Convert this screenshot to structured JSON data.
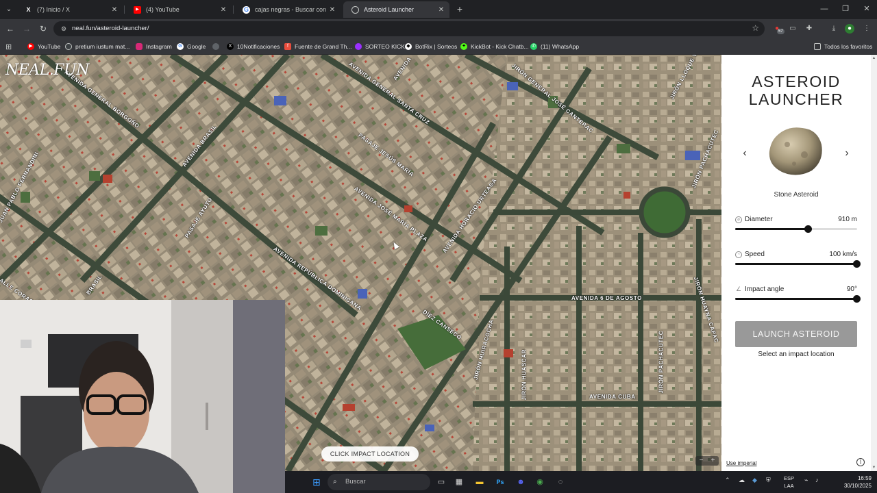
{
  "browser": {
    "tabs": [
      {
        "title": "(7) Inicio / X",
        "icon": "x-logo-icon",
        "active": false
      },
      {
        "title": "(4) YouTube",
        "icon": "youtube-icon",
        "active": false
      },
      {
        "title": "cajas negras - Buscar con Google",
        "icon": "google-icon",
        "active": false
      },
      {
        "title": "Asteroid Launcher",
        "icon": "neal-fun-icon",
        "active": true
      }
    ],
    "new_tab": "+",
    "url": "neal.fun/asteroid-launcher/",
    "extension_badge": "57",
    "bookmarks": [
      {
        "label": "YouTube",
        "color": "#ff0000"
      },
      {
        "label": "pretium iustum mat...",
        "color": "#4285f4"
      },
      {
        "label": "Instagram",
        "color": "#d62976"
      },
      {
        "label": "Google",
        "color": "#4285f4"
      },
      {
        "label": "",
        "color": "#9aa0a6"
      },
      {
        "label": "10Notificaciones",
        "color": "#000000"
      },
      {
        "label": "Fuente de Grand Th...",
        "color": "#e84d3d"
      },
      {
        "label": "SORTEO KICK",
        "color": "#9b30ff"
      },
      {
        "label": "BotRix | Sorteos",
        "color": "#ffffff"
      },
      {
        "label": "KickBot - Kick Chatb...",
        "color": "#53fc18"
      },
      {
        "label": "(11) WhatsApp",
        "color": "#25d366"
      }
    ],
    "all_bookmarks": "Todos los favoritos"
  },
  "map": {
    "logo": "NEAL.FUN",
    "cta": "CLICK IMPACT LOCATION",
    "streets": [
      "AVENIDA GENERAL BORGOÑO",
      "AVENIDA BRASIL",
      "JUAN PABLO FERNANDINI",
      "PASAJE AYUTO",
      "ALLE CORACE",
      "BRASIL",
      "AVENIDA REPÚBLICA DOMINICANA",
      "PASAJE JESÚS MARÍA",
      "AVENIDA JOSÉ MARÍA PLAZA",
      "AVENIDA HORACIO URTEAGA",
      "DÍEZ CANSECO",
      "JIRÓN HUIRACOCHA",
      "JIRÓN HUASCAR",
      "AVENIDA 6 DE AGOSTO",
      "AVENIDA CUBA",
      "JIRÓN PACHACUTEC",
      "JIRÓN HUAYNA CAPAC",
      "JIRÓN GENERAL JOSÉ CANTERAC",
      "JIRÓN LLOQUE YUPANQUI",
      "JIRÓN PACHACUTEC",
      "AVENIDA GENERAL SANTA CRUZ",
      "AVENIDA"
    ]
  },
  "panel": {
    "title_line1": "ASTEROID",
    "title_line2": "LAUNCHER",
    "prev": "‹",
    "next": "›",
    "asteroid_name": "Stone Asteroid",
    "diameter": {
      "label": "Diameter",
      "value": "910 m",
      "level": 0.6
    },
    "speed": {
      "label": "Speed",
      "value": "100 km/s",
      "level": 1.0
    },
    "angle": {
      "label": "Impact angle",
      "value": "90°",
      "level": 1.0
    },
    "launch": "LAUNCH ASTEROID",
    "hint": "Select an impact location",
    "imperial": "Use imperial",
    "info": "i"
  },
  "taskbar": {
    "search_placeholder": "Buscar",
    "lang_line1": "ESP",
    "lang_line2": "LAA",
    "time": "16:59",
    "date": "30/10/2025",
    "discord_badge": "99"
  }
}
